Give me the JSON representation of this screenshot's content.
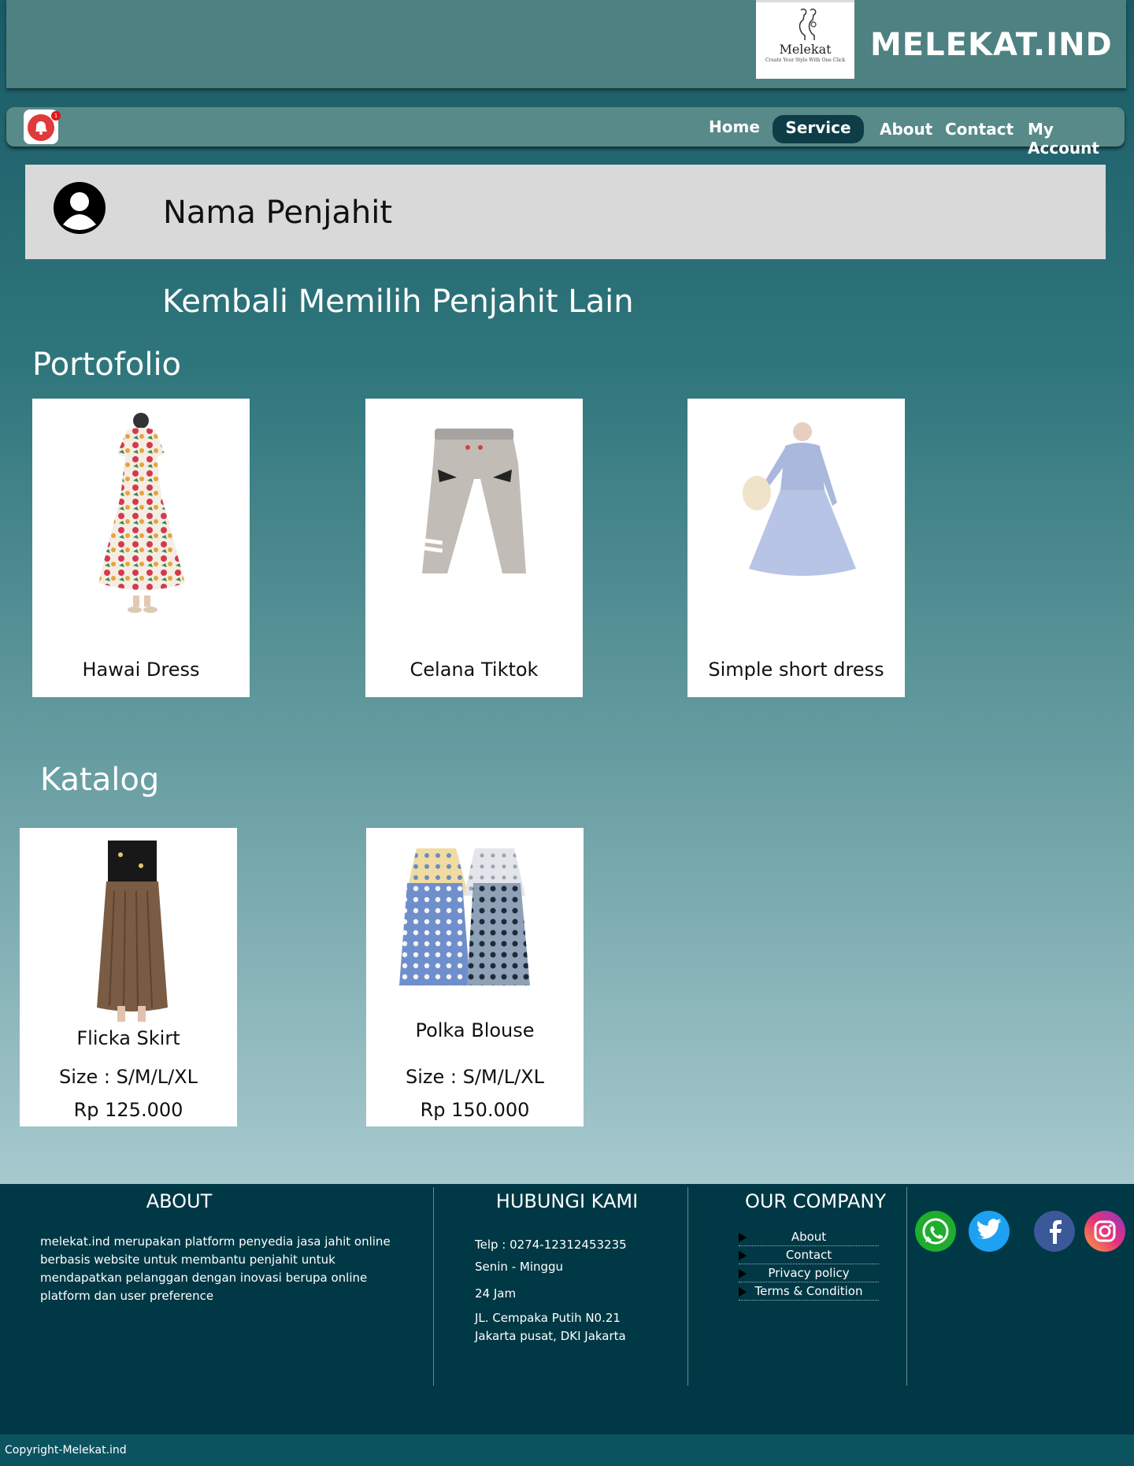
{
  "header": {
    "logo_name": "Melekat",
    "logo_tagline": "Create Your Style With One Click",
    "brand": "MELEKAT.IND"
  },
  "nav": {
    "notification_count": "1",
    "items": [
      {
        "label": "Home"
      },
      {
        "label": "Service"
      },
      {
        "label": "About"
      },
      {
        "label": "Contact"
      },
      {
        "label": "My Account"
      }
    ],
    "active": "Service"
  },
  "tailor": {
    "name": "Nama Penjahit",
    "back_link": "Kembali Memilih Penjahit Lain"
  },
  "portfolio": {
    "title": "Portofolio",
    "items": [
      {
        "title": "Hawai Dress"
      },
      {
        "title": "Celana Tiktok"
      },
      {
        "title": "Simple short dress"
      }
    ]
  },
  "katalog": {
    "title": "Katalog",
    "items": [
      {
        "title": "Flicka Skirt",
        "size": "Size : S/M/L/XL",
        "price": "Rp 125.000"
      },
      {
        "title": "Polka Blouse",
        "size": "Size :  S/M/L/XL",
        "price": "Rp 150.000"
      }
    ]
  },
  "footer": {
    "about_title": "ABOUT",
    "about_text": "melekat.ind merupakan platform penyedia jasa jahit online berbasis website untuk membantu penjahit untuk mendapatkan pelanggan dengan inovasi berupa online platform dan user preference",
    "contact_title": "HUBUNGI KAMI",
    "phone": "Telp  :  0274-12312453235",
    "days": "Senin - Minggu",
    "hours": "24 Jam",
    "address_line1": "JL. Cempaka Putih N0.21",
    "address_line2": "Jakarta pusat, DKI Jakarta",
    "company_title": "OUR COMPANY",
    "links": [
      {
        "label": "About"
      },
      {
        "label": "Contact"
      },
      {
        "label": "Privacy policy"
      },
      {
        "label": "Terms & Condition"
      }
    ],
    "social": [
      "whatsapp-icon",
      "twitter-icon",
      "facebook-icon",
      "instagram-icon"
    ],
    "copyright": "Copyright-Melekat.ind"
  },
  "colors": {
    "topbar": "#4d8182",
    "navbar": "#578a89",
    "active_tab": "#0e3d48",
    "footer": "#003845",
    "copyright_bar": "#0c5360"
  }
}
